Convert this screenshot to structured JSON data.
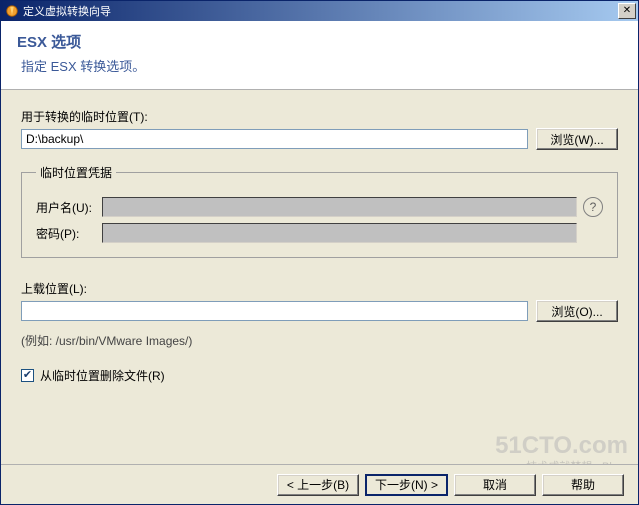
{
  "title": "定义虚拟转换向导",
  "header": {
    "title": "ESX 选项",
    "subtitle": "指定 ESX 转换选项。"
  },
  "temp": {
    "label": "用于转换的临时位置(T):",
    "value": "D:\\backup\\",
    "browse": "浏览(W)..."
  },
  "creds": {
    "legend": "临时位置凭据",
    "user_label": "用户名(U):",
    "user_value": "",
    "pass_label": "密码(P):",
    "pass_value": ""
  },
  "upload": {
    "label": "上载位置(L):",
    "value": "",
    "browse": "浏览(O)...",
    "example": "(例如: /usr/bin/VMware Images/)"
  },
  "delete_label": "从临时位置删除文件(R)",
  "footer": {
    "back": "< 上一步(B)",
    "next": "下一步(N) >",
    "cancel": "取消",
    "help": "帮助"
  },
  "watermark": "51CTO.com",
  "watermark_sub": "技术成就梦想 - Blog"
}
